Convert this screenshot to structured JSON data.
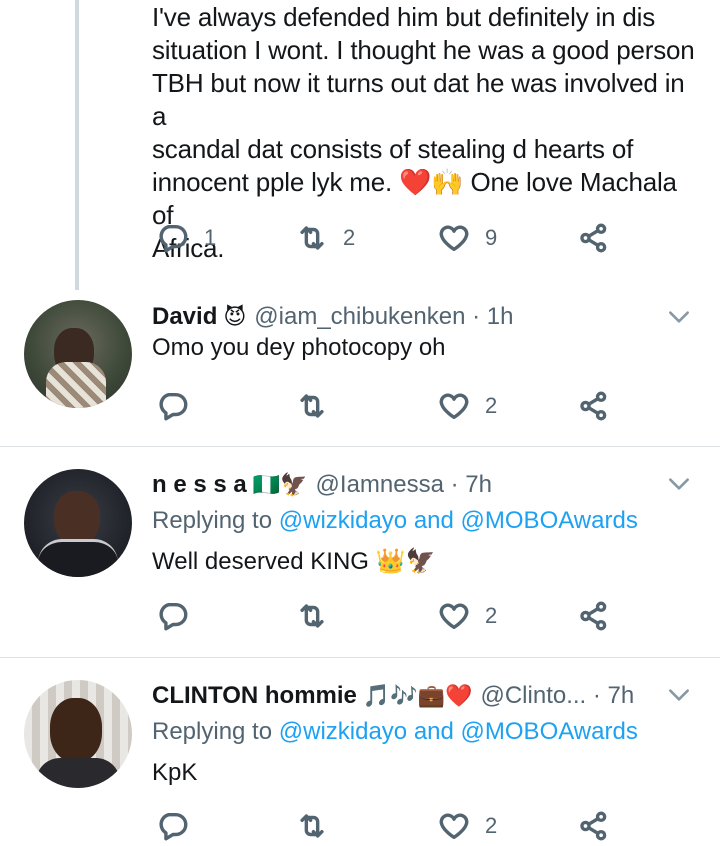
{
  "tweets": [
    {
      "text_lines": [
        "I've always defended him but definitely in dis",
        "situation I wont. I thought he was a good person",
        "TBH but now it turns out dat he was involved in a",
        "scandal dat consists of stealing d hearts of",
        "innocent pple lyk me. ❤️🙌 One love Machala of",
        "Africa."
      ],
      "replies": "1",
      "retweets": "2",
      "likes": "9"
    },
    {
      "name": "David",
      "name_emoji": "😈",
      "handle": "@iam_chibukenken · 1h",
      "text": "Omo you dey photocopy oh",
      "replies": "",
      "retweets": "",
      "likes": "2"
    },
    {
      "name": "n e s s a",
      "name_emoji": "🇳🇬🦅",
      "handle": "@Iamnessa · 7h",
      "replying_prefix": "Replying to ",
      "replying_mentions": "@wizkidayo and @MOBOAwards",
      "text": "Well deserved KING 👑🦅",
      "replies": "",
      "retweets": "",
      "likes": "2"
    },
    {
      "name": "CLINTON hommie",
      "name_emoji": "🎵🎶💼❤️",
      "handle": "@Clinto... · 7h",
      "replying_prefix": "Replying to ",
      "replying_mentions": "@wizkidayo and @MOBOAwards",
      "text": "KpK",
      "replies": "",
      "retweets": "",
      "likes": "2"
    }
  ],
  "icons": {
    "reply": "reply-icon",
    "retweet": "retweet-icon",
    "like": "heart-icon",
    "share": "share-icon",
    "more": "chevron-down-icon"
  },
  "colors": {
    "text": "#14171a",
    "secondary": "#536471",
    "link": "#1da1f2",
    "thread_line": "#cfd9de",
    "divider": "#dfe3e6"
  }
}
